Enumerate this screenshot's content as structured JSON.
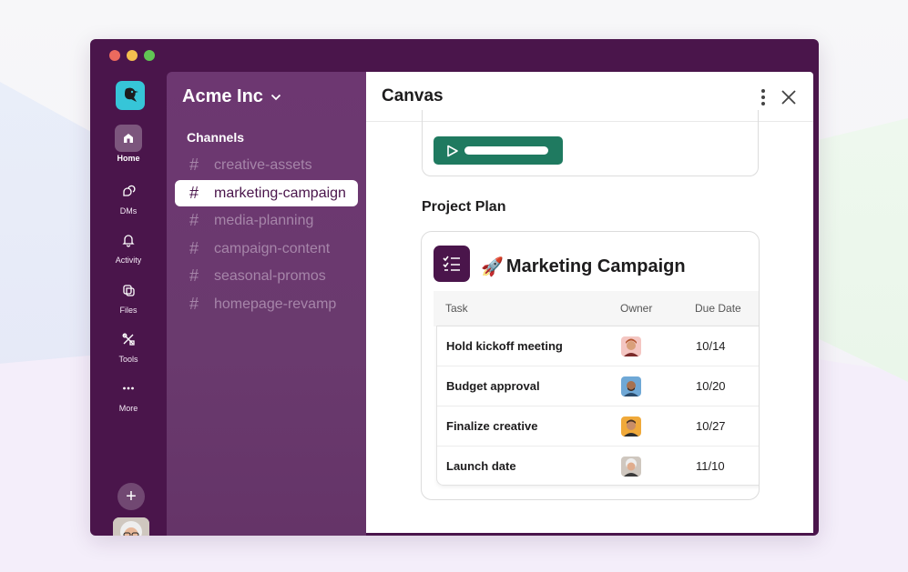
{
  "window": {
    "traffic_lights": {
      "red": "#ec6a5e",
      "yellow": "#f4bf4f",
      "green": "#61c554"
    },
    "brand_color": "#4a154b"
  },
  "rail": {
    "items": [
      {
        "label": "Home",
        "icon": "home-icon",
        "active": true
      },
      {
        "label": "DMs",
        "icon": "dm-icon",
        "active": false
      },
      {
        "label": "Activity",
        "icon": "bell-icon",
        "active": false
      },
      {
        "label": "Files",
        "icon": "files-icon",
        "active": false
      },
      {
        "label": "Tools",
        "icon": "tools-icon",
        "active": false
      },
      {
        "label": "More",
        "icon": "more-icon",
        "active": false
      }
    ],
    "add_label": "+"
  },
  "sidebar": {
    "workspace_name": "Acme Inc",
    "channels_heading": "Channels",
    "channels": [
      {
        "name": "creative-assets",
        "active": false
      },
      {
        "name": "marketing-campaign",
        "active": true
      },
      {
        "name": "media-planning",
        "active": false
      },
      {
        "name": "campaign-content",
        "active": false
      },
      {
        "name": "seasonal-promos",
        "active": false
      },
      {
        "name": "homepage-revamp",
        "active": false
      }
    ],
    "hash_symbol": "#"
  },
  "canvas": {
    "title": "Canvas",
    "section_title": "Project Plan",
    "project": {
      "emoji": "🚀",
      "title": "Marketing Campaign",
      "columns": [
        "Task",
        "Owner",
        "Due Date"
      ],
      "rows": [
        {
          "task": "Hold kickoff meeting",
          "owner": "owner-avatar-1",
          "due": "10/14"
        },
        {
          "task": "Budget approval",
          "owner": "owner-avatar-2",
          "due": "10/20"
        },
        {
          "task": "Finalize creative",
          "owner": "owner-avatar-3",
          "due": "10/27"
        },
        {
          "task": "Launch date",
          "owner": "owner-avatar-4",
          "due": "11/10"
        }
      ]
    },
    "accent_green": "#1f7a60"
  }
}
